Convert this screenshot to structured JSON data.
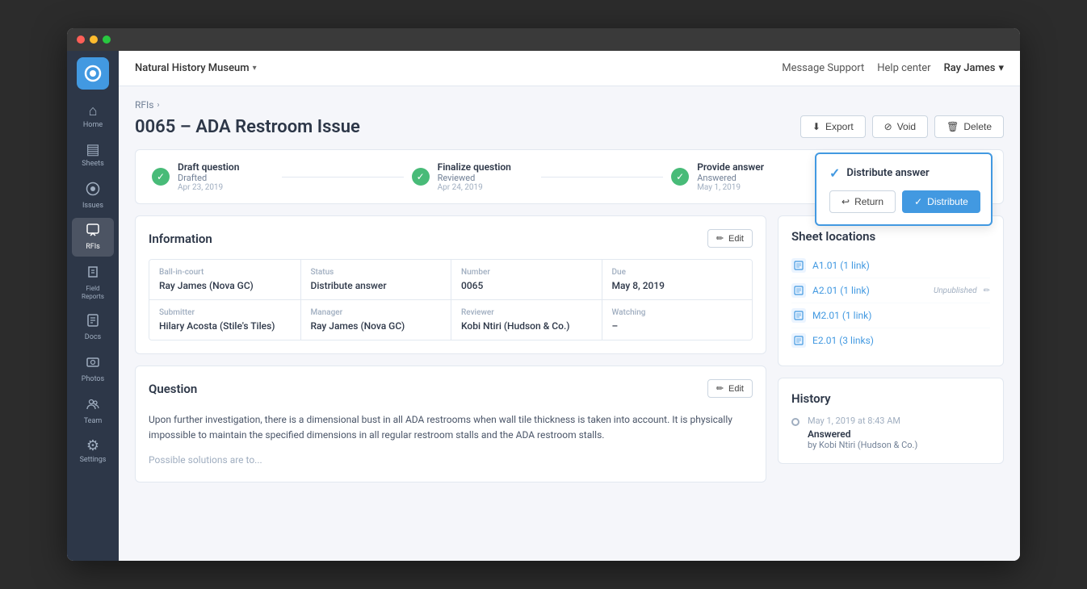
{
  "chrome": {
    "dots": [
      "red",
      "yellow",
      "green"
    ]
  },
  "sidebar": {
    "logo_symbol": "◯",
    "items": [
      {
        "id": "home",
        "icon": "⌂",
        "label": "Home",
        "active": false
      },
      {
        "id": "sheets",
        "icon": "▤",
        "label": "Sheets",
        "active": false
      },
      {
        "id": "issues",
        "icon": "◉",
        "label": "Issues",
        "active": false
      },
      {
        "id": "rfis",
        "icon": "💬",
        "label": "RFIs",
        "active": true
      },
      {
        "id": "field-reports",
        "icon": "⚑",
        "label": "Field Reports",
        "active": false
      },
      {
        "id": "docs",
        "icon": "📄",
        "label": "Docs",
        "active": false
      },
      {
        "id": "photos",
        "icon": "📷",
        "label": "Photos",
        "active": false
      },
      {
        "id": "team",
        "icon": "👥",
        "label": "Team",
        "active": false
      },
      {
        "id": "settings",
        "icon": "⚙",
        "label": "Settings",
        "active": false
      }
    ]
  },
  "topnav": {
    "project": "Natural History Museum",
    "chevron": "▾",
    "links": [
      "Message Support",
      "Help center"
    ],
    "user": "Ray James",
    "user_chevron": "▾"
  },
  "breadcrumb": {
    "parent": "RFIs",
    "chevron": "›"
  },
  "page": {
    "title": "0065 – ADA Restroom Issue",
    "actions": [
      {
        "id": "export",
        "label": "Export",
        "icon": "⬇"
      },
      {
        "id": "void",
        "label": "Void",
        "icon": "⊘"
      },
      {
        "id": "delete",
        "label": "Delete",
        "icon": "🗑"
      }
    ]
  },
  "progress": {
    "steps": [
      {
        "id": "draft",
        "title": "Draft question",
        "sub": "Drafted",
        "date": "Apr 23, 2019",
        "completed": true
      },
      {
        "id": "finalize",
        "title": "Finalize question",
        "sub": "Reviewed",
        "date": "Apr 24, 2019",
        "completed": true
      },
      {
        "id": "provide",
        "title": "Provide answer",
        "sub": "Answered",
        "date": "May 1, 2019",
        "completed": true
      }
    ]
  },
  "distribute_popup": {
    "title": "Distribute answer",
    "check_icon": "✓",
    "return_label": "Return",
    "distribute_label": "Distribute"
  },
  "information": {
    "title": "Information",
    "edit_label": "Edit",
    "fields_row1": [
      {
        "label": "Ball-in-court",
        "value": "Ray James (Nova GC)"
      },
      {
        "label": "Status",
        "value": "Distribute answer"
      },
      {
        "label": "Number",
        "value": "0065"
      },
      {
        "label": "Due",
        "value": "May 8, 2019"
      }
    ],
    "fields_row2": [
      {
        "label": "Submitter",
        "value": "Hilary Acosta (Stile's Tiles)"
      },
      {
        "label": "Manager",
        "value": "Ray James (Nova GC)"
      },
      {
        "label": "Reviewer",
        "value": "Kobi Ntiri (Hudson & Co.)"
      },
      {
        "label": "Watching",
        "value": "–"
      }
    ]
  },
  "question": {
    "title": "Question",
    "edit_label": "Edit",
    "text": "Upon further investigation, there is a dimensional bust in all ADA restrooms when wall tile thickness is taken into account. It is physically impossible to maintain the specified dimensions in all regular restroom stalls and the ADA restroom stalls.",
    "text2": "Possible solutions are to..."
  },
  "sheet_locations": {
    "title": "Sheet locations",
    "items": [
      {
        "id": "a101",
        "label": "A1.01 (1 link)",
        "unpublished": false
      },
      {
        "id": "a201",
        "label": "A2.01 (1 link)",
        "unpublished": true
      },
      {
        "id": "m201",
        "label": "M2.01 (1 link)",
        "unpublished": false
      },
      {
        "id": "e201",
        "label": "E2.01 (3 links)",
        "unpublished": false
      }
    ],
    "unpublished_label": "Unpublished"
  },
  "history": {
    "title": "History",
    "items": [
      {
        "time": "May 1, 2019 at 8:43 AM",
        "action": "Answered",
        "by": "by Kobi Ntiri (Hudson & Co.)"
      }
    ]
  }
}
